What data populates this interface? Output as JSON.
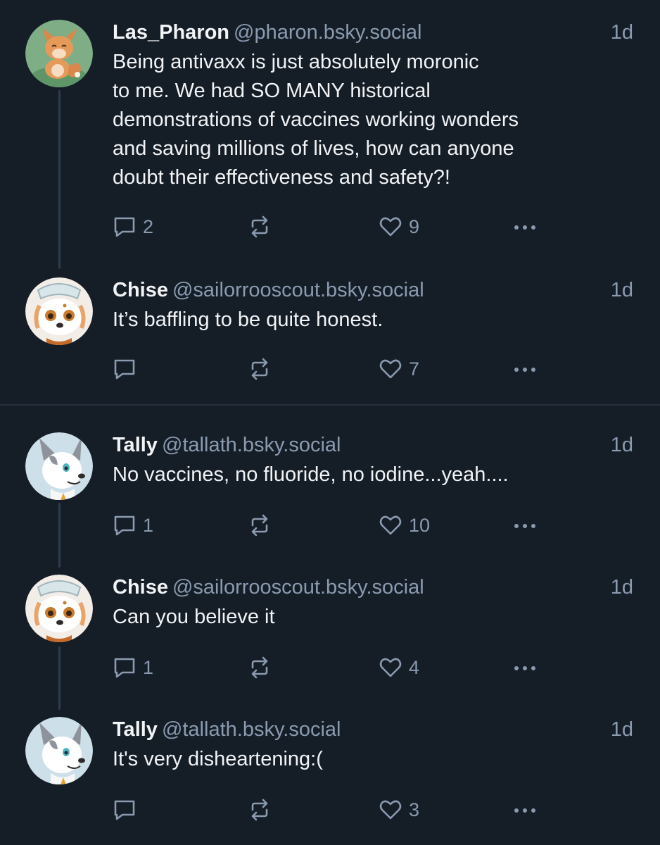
{
  "colors": {
    "background": "#151d27",
    "text": "#f1f3f5",
    "muted": "#8a9bb0",
    "thread_line": "#2e3c4d"
  },
  "icons": {
    "reply": "speech-bubble-icon",
    "repost": "repost-arrows-icon",
    "like": "heart-icon",
    "more": "ellipsis-icon"
  },
  "threads": [
    {
      "posts": [
        {
          "display_name": "Las_Pharon",
          "handle": "@pharon.bsky.social",
          "time": "1d",
          "text": "Being antivaxx is just absolutely moronic\nto me. We had SO MANY historical\ndemonstrations of vaccines working wonders\nand saving millions of lives, how can anyone\ndoubt their effectiveness and safety?!",
          "replies": "2",
          "likes": "9"
        },
        {
          "display_name": "Chise",
          "handle": "@sailorrooscout.bsky.social",
          "time": "1d",
          "text": "It’s baffling to be quite honest.",
          "replies": "",
          "likes": "7"
        }
      ]
    },
    {
      "posts": [
        {
          "display_name": "Tally",
          "handle": "@tallath.bsky.social",
          "time": "1d",
          "text": "No vaccines, no fluoride, no iodine...yeah....",
          "replies": "1",
          "likes": "10"
        },
        {
          "display_name": "Chise",
          "handle": "@sailorrooscout.bsky.social",
          "time": "1d",
          "text": "Can you believe it",
          "replies": "1",
          "likes": "4"
        },
        {
          "display_name": "Tally",
          "handle": "@tallath.bsky.social",
          "time": "1d",
          "text": "It's very disheartening:(",
          "replies": "",
          "likes": "3"
        }
      ]
    }
  ]
}
